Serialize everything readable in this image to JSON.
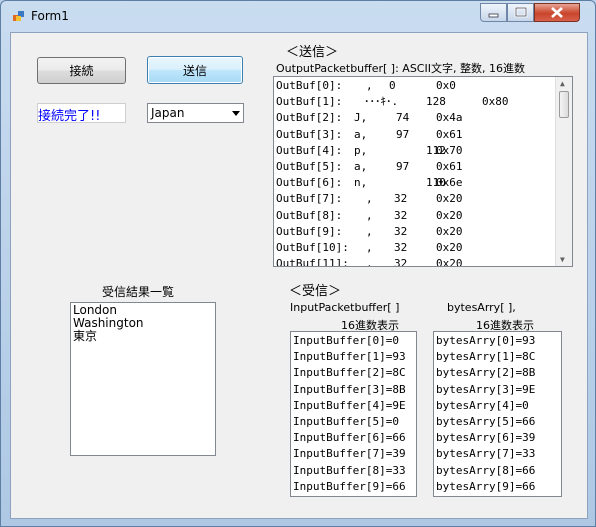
{
  "window": {
    "title": "Form1"
  },
  "buttons": {
    "connect": "接続",
    "send": "送信"
  },
  "status_text": "接続完了!!",
  "country_select": {
    "value": "Japan"
  },
  "send_section": {
    "heading": "＜送信＞",
    "caption": "OutputPacketbuffer[ ]:  ASCII文字, 整数, 16進数",
    "rows": [
      {
        "name": "OutBuf[0]:",
        "ch": ",",
        "dec": "0",
        "hex": "0x0"
      },
      {
        "name": "OutBuf[1]:",
        "ch": "･･･ｷ･.",
        "dec": "128",
        "hex": "0x80"
      },
      {
        "name": "OutBuf[2]:",
        "ch": "J,",
        "dec": "74",
        "hex": "0x4a"
      },
      {
        "name": "OutBuf[3]:",
        "ch": "a,",
        "dec": "97",
        "hex": "0x61"
      },
      {
        "name": "OutBuf[4]:",
        "ch": "p,",
        "dec": "112",
        "hex": "0x70"
      },
      {
        "name": "OutBuf[5]:",
        "ch": "a,",
        "dec": "97",
        "hex": "0x61"
      },
      {
        "name": "OutBuf[6]:",
        "ch": "n,",
        "dec": "110",
        "hex": "0x6e"
      },
      {
        "name": "OutBuf[7]:",
        "ch": ",",
        "dec": "32",
        "hex": "0x20"
      },
      {
        "name": "OutBuf[8]:",
        "ch": ",",
        "dec": "32",
        "hex": "0x20"
      },
      {
        "name": "OutBuf[9]:",
        "ch": ",",
        "dec": "32",
        "hex": "0x20"
      },
      {
        "name": "OutBuf[10]:",
        "ch": ",",
        "dec": "32",
        "hex": "0x20"
      },
      {
        "name": "OutBuf[11]:",
        "ch": ",",
        "dec": "32",
        "hex": "0x20"
      }
    ]
  },
  "results_section": {
    "label": "受信結果一覧",
    "items": [
      "London",
      "Washington",
      "東京"
    ]
  },
  "receive_section": {
    "heading": "＜受信＞",
    "input_caption_1": "InputPacketbuffer[ ]",
    "input_caption_2": "16進数表示",
    "bytes_caption_1": "bytesArry[ ],",
    "bytes_caption_2": "16進数表示",
    "input_items": [
      "InputBuffer[0]=0",
      "InputBuffer[1]=93",
      "InputBuffer[2]=8C",
      "InputBuffer[3]=8B",
      "InputBuffer[4]=9E",
      "InputBuffer[5]=0",
      "InputBuffer[6]=66",
      "InputBuffer[7]=39",
      "InputBuffer[8]=33",
      "InputBuffer[9]=66"
    ],
    "bytes_items": [
      "bytesArry[0]=93",
      "bytesArry[1]=8C",
      "bytesArry[2]=8B",
      "bytesArry[3]=9E",
      "bytesArry[4]=0",
      "bytesArry[5]=66",
      "bytesArry[6]=39",
      "bytesArry[7]=33",
      "bytesArry[8]=66",
      "bytesArry[9]=66"
    ]
  },
  "icons": {
    "app": "form-app-icon",
    "minimize": "minimize-icon",
    "maximize": "maximize-icon",
    "close": "close-icon",
    "dropdown": "chevron-down-icon",
    "scroll_up": "scroll-up-icon",
    "scroll_down": "scroll-down-icon"
  },
  "colors": {
    "status": "#0000ff",
    "close_button": "#c9452b",
    "focus_border": "#3c7fb1"
  }
}
